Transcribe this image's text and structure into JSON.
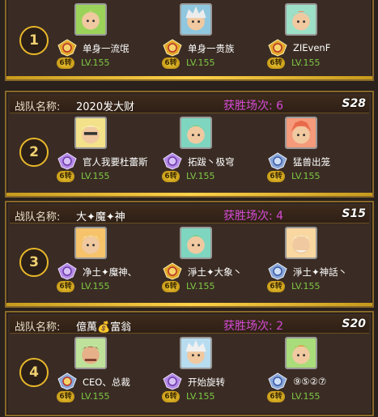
{
  "labels": {
    "team_label": "战队名称:",
    "wins_prefix": "获胜场次: "
  },
  "teams": [
    {
      "rank": "1",
      "name": "",
      "wins": "",
      "server": "",
      "members": [
        {
          "name": "单身一流氓",
          "level": "LV.155",
          "tier": "6转",
          "badge": "gold-crest-icon",
          "avatar": "#9bd35a"
        },
        {
          "name": "单身一贵族",
          "level": "LV.155",
          "tier": "6转",
          "badge": "gold-crest-icon",
          "avatar": "#8fc7df"
        },
        {
          "name": "ZIEvenF",
          "level": "LV.155",
          "tier": "6转",
          "badge": "gold-crest-icon",
          "avatar": "#9de0c8"
        }
      ]
    },
    {
      "rank": "2",
      "name": "2020发大财",
      "wins": "6",
      "server": "S28",
      "members": [
        {
          "name": "官人我要杜蕾斯",
          "level": "LV.155",
          "tier": "6转",
          "badge": "purple-crest-icon",
          "avatar": "#f3e28a"
        },
        {
          "name": "拓跋丶极穹",
          "level": "LV.155",
          "tier": "6转",
          "badge": "purple-crest-icon",
          "avatar": "#7fd6c0"
        },
        {
          "name": "猛兽出笼",
          "level": "LV.155",
          "tier": "6转",
          "badge": "silver-crest-icon",
          "avatar": "#f59a7a"
        }
      ]
    },
    {
      "rank": "3",
      "name": "大✦魔✦神",
      "wins": "4",
      "server": "S15",
      "members": [
        {
          "name": "净土✦魔神、",
          "level": "LV.155",
          "tier": "6转",
          "badge": "purple-crest-icon",
          "avatar": "#f6c36b"
        },
        {
          "name": "淨土✦大象丶",
          "level": "LV.155",
          "tier": "6转",
          "badge": "gold-crest-icon",
          "avatar": "#7fd6c0"
        },
        {
          "name": "淨土✦神話丶",
          "level": "LV.155",
          "tier": "6转",
          "badge": "silver-crest-icon",
          "avatar": "#f8d7a0"
        }
      ]
    },
    {
      "rank": "4",
      "name": "億萬💰富翁",
      "wins": "2",
      "server": "S20",
      "members": [
        {
          "name": "CEO、总裁",
          "level": "LV.155",
          "tier": "6转",
          "badge": "silver-crest-icon",
          "avatar": "#bfe29a"
        },
        {
          "name": "开始旋转",
          "level": "LV.155",
          "tier": "6转",
          "badge": "purple-crest-icon",
          "avatar": "#b8dcef"
        },
        {
          "name": "⑨⑤②⑦",
          "level": "LV.155",
          "tier": "6转",
          "badge": "silver-crest-icon",
          "avatar": "#a9dc7a"
        }
      ]
    }
  ],
  "colors": {
    "wins": "#d44bd6",
    "level": "#7fc844",
    "accent": "#e8b72a"
  }
}
